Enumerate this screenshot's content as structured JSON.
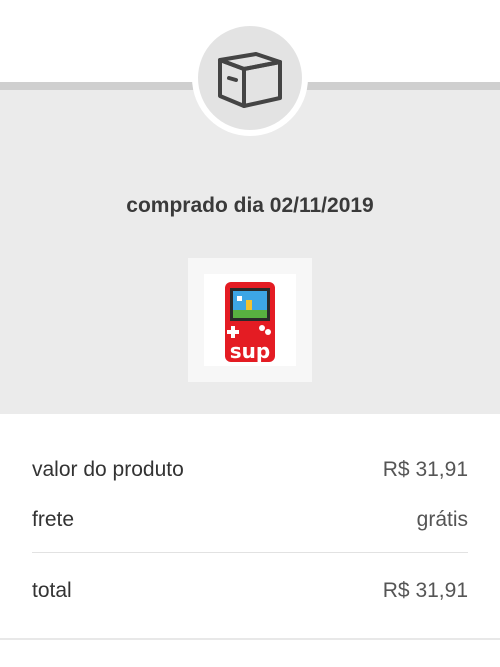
{
  "header": {
    "icon": "box-icon",
    "purchase_date": "comprado dia 02/11/2019"
  },
  "product": {
    "image": "handheld-game-console-thumbnail",
    "brand_text": "sup"
  },
  "summary": {
    "product_value_label": "valor do produto",
    "product_value": "R$ 31,91",
    "shipping_label": "frete",
    "shipping_value": "grátis",
    "total_label": "total",
    "total_value": "R$ 31,91"
  }
}
